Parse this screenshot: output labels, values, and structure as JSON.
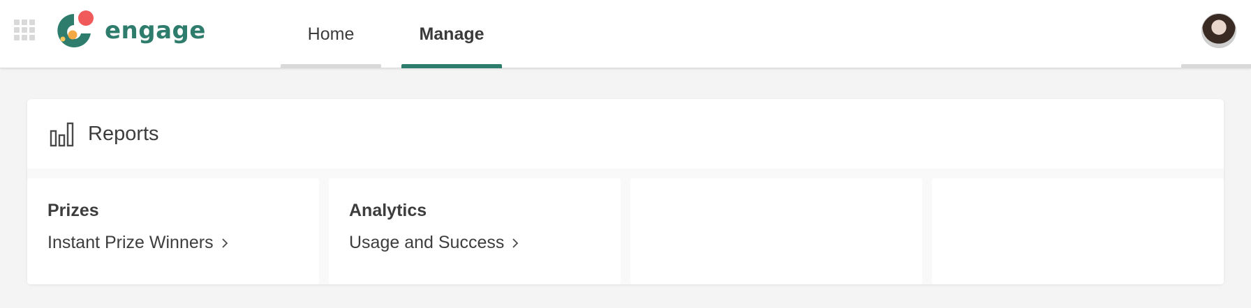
{
  "app": {
    "logo_text": "engage",
    "brand_color": "#2e7d6c",
    "logo_accents": [
      "#f05a5a",
      "#f4a945",
      "#f6c75a"
    ]
  },
  "nav": {
    "tabs": [
      {
        "label": "Home",
        "active": false
      },
      {
        "label": "Manage",
        "active": true
      }
    ]
  },
  "reports": {
    "title": "Reports",
    "icon": "bar-chart-icon",
    "tiles": [
      {
        "heading": "Prizes",
        "link": "Instant Prize Winners"
      },
      {
        "heading": "Analytics",
        "link": "Usage and Success"
      },
      {
        "heading": "",
        "link": ""
      },
      {
        "heading": "",
        "link": ""
      }
    ]
  }
}
